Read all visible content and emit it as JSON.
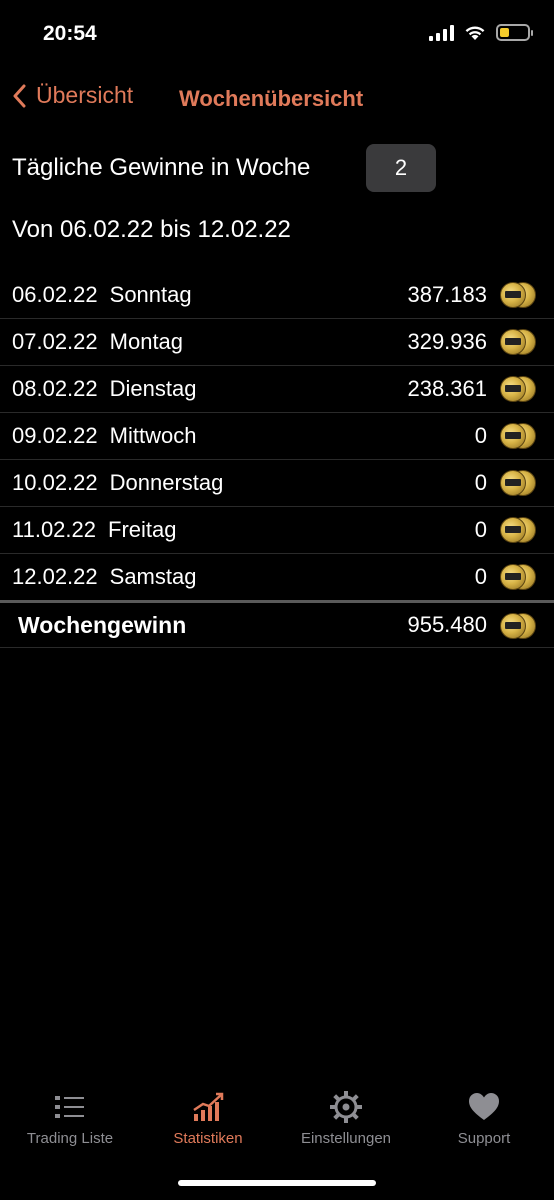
{
  "status_bar": {
    "time": "20:54"
  },
  "nav": {
    "back_label": "Übersicht",
    "title": "Wochenübersicht"
  },
  "header": {
    "week_label": "Tägliche Gewinne in Woche",
    "week_number": "2",
    "range": "Von 06.02.22 bis 12.02.22"
  },
  "rows": [
    {
      "date": "06.02.22",
      "day": "Sonntag",
      "amount": "387.183"
    },
    {
      "date": "07.02.22",
      "day": "Montag",
      "amount": "329.936"
    },
    {
      "date": "08.02.22",
      "day": "Dienstag",
      "amount": "238.361"
    },
    {
      "date": "09.02.22",
      "day": "Mittwoch",
      "amount": "0"
    },
    {
      "date": "10.02.22",
      "day": "Donnerstag",
      "amount": "0"
    },
    {
      "date": "11.02.22",
      "day": "Freitag",
      "amount": "0"
    },
    {
      "date": "12.02.22",
      "day": "Samstag",
      "amount": "0"
    }
  ],
  "total": {
    "label": "Wochengewinn",
    "amount": "955.480"
  },
  "tabbar": {
    "items": [
      {
        "label": "Trading Liste",
        "icon": "list-icon",
        "active": false
      },
      {
        "label": "Statistiken",
        "icon": "chart-icon",
        "active": true
      },
      {
        "label": "Einstellungen",
        "icon": "gear-icon",
        "active": false
      },
      {
        "label": "Support",
        "icon": "heart-icon",
        "active": false
      }
    ]
  },
  "colors": {
    "accent": "#e07a5a",
    "background": "#000000",
    "inactive_tab": "#8e8e93"
  }
}
